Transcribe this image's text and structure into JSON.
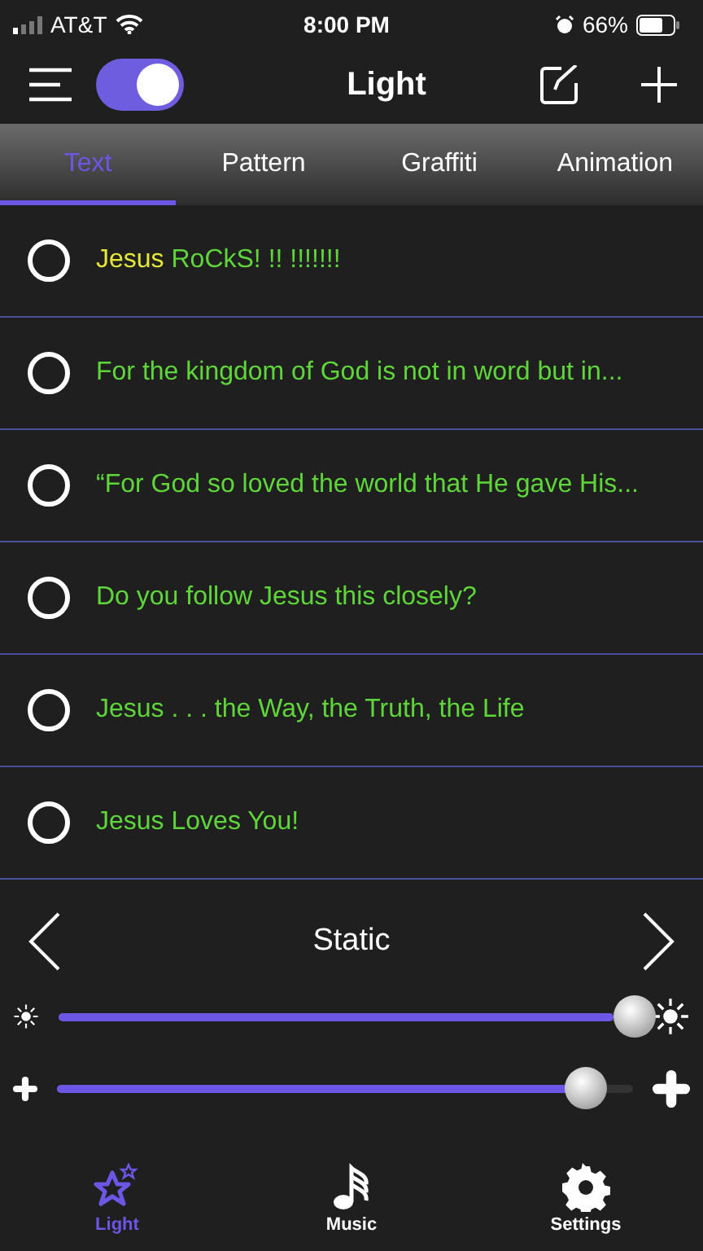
{
  "status_bar": {
    "carrier": "AT&T",
    "time": "8:00 PM",
    "battery": "66%"
  },
  "header": {
    "title": "Light",
    "toggle": {
      "on": true
    }
  },
  "tabs": [
    {
      "label": "Text",
      "selected": true
    },
    {
      "label": "Pattern",
      "selected": false
    },
    {
      "label": "Graffiti",
      "selected": false
    },
    {
      "label": "Animation",
      "selected": false
    }
  ],
  "items": [
    {
      "checked": false,
      "segments": [
        {
          "text": "Jesus",
          "color": "#e6e63a"
        },
        {
          "text": "RoCkS! !! !!!!!!!",
          "color": "#5ed63a"
        }
      ]
    },
    {
      "checked": false,
      "segments": [
        {
          "text": "For the kingdom of God is not in word but in...",
          "color": "#5ed63a"
        }
      ]
    },
    {
      "checked": false,
      "segments": [
        {
          "text": "“For God so loved the world that He gave His...",
          "color": "#5ed63a"
        }
      ]
    },
    {
      "checked": false,
      "segments": [
        {
          "text": "Do you follow Jesus this closely?",
          "color": "#5ed63a"
        }
      ]
    },
    {
      "checked": false,
      "segments": [
        {
          "text": "Jesus . . . the Way, the Truth, the Life",
          "color": "#5ed63a"
        }
      ]
    },
    {
      "checked": false,
      "segments": [
        {
          "text": "Jesus Loves You!",
          "color": "#5ed63a"
        }
      ]
    }
  ],
  "mode": {
    "label": "Static"
  },
  "sliders": [
    {
      "kind": "brightness",
      "level": 0.97
    },
    {
      "kind": "size",
      "level": 0.89
    }
  ],
  "bottom_nav": [
    {
      "label": "Light",
      "selected": true
    },
    {
      "label": "Music",
      "selected": false
    },
    {
      "label": "Settings",
      "selected": false
    }
  ]
}
